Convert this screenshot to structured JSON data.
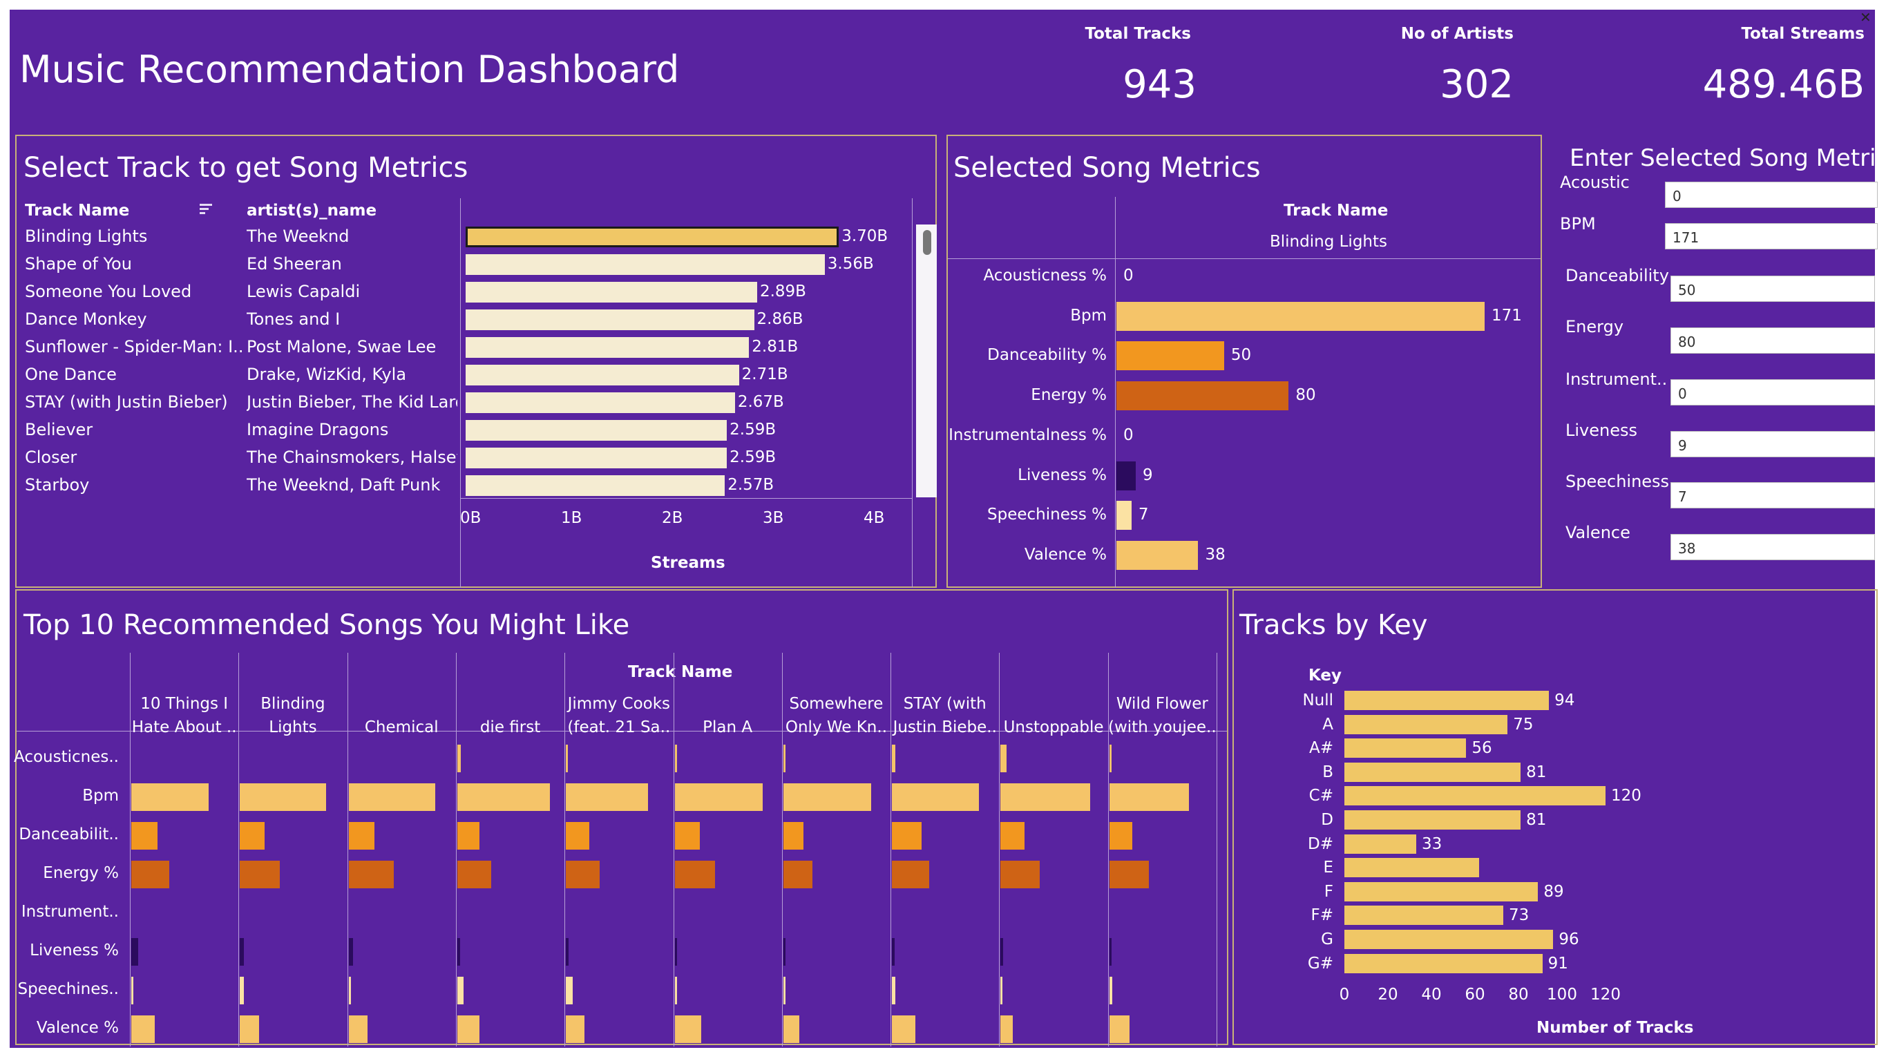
{
  "title": "Music Recommendation Dashboard",
  "kpis": [
    {
      "label": "Total Tracks",
      "value": "943"
    },
    {
      "label": "No of Artists",
      "value": "302"
    },
    {
      "label": "Total Streams",
      "value": "489.46B"
    }
  ],
  "colors": {
    "background": "#5923a0",
    "selected_bar": "#f0c766",
    "bar_light": "#f5ecd2",
    "bpm": "#f5c469",
    "danceability": "#f2971f",
    "energy": "#cf6315",
    "liveness": "#2b0b5e",
    "speechiness": "#fbe2a3",
    "valence": "#f5c469",
    "key_bar": "#f0c766"
  },
  "select_panel": {
    "title": "Select Track to get Song Metrics",
    "col_track": "Track Name",
    "col_artist": "artist(s)_name",
    "sort_icon": "sort-icon",
    "x_axis_title": "Streams",
    "x_ticks": [
      "0B",
      "1B",
      "2B",
      "3B",
      "4B"
    ],
    "rows": [
      {
        "track": "Blinding Lights",
        "artist": "The Weeknd",
        "label": "3.70B",
        "selected": true
      },
      {
        "track": "Shape of You",
        "artist": "Ed Sheeran",
        "label": "3.56B"
      },
      {
        "track": "Someone You Loved",
        "artist": "Lewis Capaldi",
        "label": "2.89B"
      },
      {
        "track": "Dance Monkey",
        "artist": "Tones and I",
        "label": "2.86B"
      },
      {
        "track": "Sunflower - Spider-Man: I..",
        "artist": "Post Malone, Swae Lee",
        "label": "2.81B"
      },
      {
        "track": "One Dance",
        "artist": "Drake, WizKid, Kyla",
        "label": "2.71B"
      },
      {
        "track": "STAY (with Justin Bieber)",
        "artist": "Justin Bieber, The Kid Laroi",
        "label": "2.67B"
      },
      {
        "track": "Believer",
        "artist": "Imagine Dragons",
        "label": "2.59B"
      },
      {
        "track": "Closer",
        "artist": "The Chainsmokers, Halsey",
        "label": "2.59B"
      },
      {
        "track": "Starboy",
        "artist": "The Weeknd, Daft Punk",
        "label": "2.57B"
      }
    ]
  },
  "metrics_panel": {
    "title": "Selected Song Metrics",
    "col_header": "Track Name",
    "track": "Blinding Lights",
    "metrics": [
      {
        "name": "Acousticness %",
        "value": 0,
        "label": "0",
        "color": "#f5c469"
      },
      {
        "name": "Bpm",
        "value": 171,
        "label": "171",
        "color": "#f5c469"
      },
      {
        "name": "Danceability %",
        "value": 50,
        "label": "50",
        "color": "#f2971f"
      },
      {
        "name": "Energy %",
        "value": 80,
        "label": "80",
        "color": "#cf6315"
      },
      {
        "name": "Instrumentalness %",
        "value": 0,
        "label": "0",
        "color": "#f5c469"
      },
      {
        "name": "Liveness %",
        "value": 9,
        "label": "9",
        "color": "#2b0b5e"
      },
      {
        "name": "Speechiness %",
        "value": 7,
        "label": "7",
        "color": "#fbe2a3"
      },
      {
        "name": "Valence %",
        "value": 38,
        "label": "38",
        "color": "#f5c469"
      }
    ]
  },
  "inputs_panel": {
    "title": "Enter Selected Song Metrics",
    "fields": [
      {
        "label": "Acoustic",
        "value": "0"
      },
      {
        "label": "BPM",
        "value": "171"
      },
      {
        "label": "Danceability",
        "value": "50"
      },
      {
        "label": "Energy",
        "value": "80"
      },
      {
        "label": "Instrument..",
        "value": "0"
      },
      {
        "label": "Liveness",
        "value": "9"
      },
      {
        "label": "Speechiness",
        "value": "7"
      },
      {
        "label": "Valence",
        "value": "38"
      }
    ]
  },
  "recommend_panel": {
    "title": "Top 10 Recommended Songs You Might Like",
    "col_header": "Track Name",
    "songs": [
      {
        "l1": "10 Things I",
        "l2": "Hate About .."
      },
      {
        "l1": "Blinding",
        "l2": "Lights"
      },
      {
        "l1": "",
        "l2": "Chemical"
      },
      {
        "l1": "",
        "l2": "die first"
      },
      {
        "l1": "Jimmy Cooks",
        "l2": "(feat. 21 Sa.."
      },
      {
        "l1": "",
        "l2": "Plan A"
      },
      {
        "l1": "Somewhere",
        "l2": "Only We Kn.."
      },
      {
        "l1": "STAY (with",
        "l2": "Justin Biebe.."
      },
      {
        "l1": "",
        "l2": "Unstoppable"
      },
      {
        "l1": "Wild Flower",
        "l2": "(with youjee.."
      }
    ],
    "row_labels": [
      "Acousticnes..",
      "Bpm",
      "Danceabilit..",
      "Energy %",
      "Instrument..",
      "Liveness %",
      "Speechines..",
      "Valence %"
    ]
  },
  "chart_data": [
    {
      "type": "bar",
      "title": "Select Track to get Song Metrics",
      "xlabel": "Streams",
      "categories": [
        "Blinding Lights",
        "Shape of You",
        "Someone You Loved",
        "Dance Monkey",
        "Sunflower - Spider-Man: I..",
        "One Dance",
        "STAY (with Justin Bieber)",
        "Believer",
        "Closer",
        "Starboy"
      ],
      "values": [
        3.7,
        3.56,
        2.89,
        2.86,
        2.81,
        2.71,
        2.67,
        2.59,
        2.59,
        2.57
      ],
      "xlim": [
        0,
        4.45
      ]
    },
    {
      "type": "bar",
      "title": "Selected Song Metrics",
      "categories": [
        "Acousticness %",
        "Bpm",
        "Danceability %",
        "Energy %",
        "Instrumentalness %",
        "Liveness %",
        "Speechiness %",
        "Valence %"
      ],
      "values": [
        0,
        171,
        50,
        80,
        0,
        9,
        7,
        38
      ],
      "xlim": [
        0,
        190
      ]
    },
    {
      "type": "bar",
      "title": "Top 10 Recommended Songs You Might Like",
      "categories": [
        "Acousticnes..",
        "Bpm",
        "Danceabilit..",
        "Energy %",
        "Instrument..",
        "Liveness %",
        "Speechines..",
        "Valence %"
      ],
      "series": [
        {
          "name": "10 Things I Hate About ..",
          "values": [
            0,
            124,
            42,
            61,
            0,
            11,
            3,
            38
          ]
        },
        {
          "name": "Blinding Lights",
          "values": [
            0,
            138,
            40,
            64,
            0,
            6,
            6,
            31
          ]
        },
        {
          "name": "Chemical",
          "values": [
            0,
            139,
            41,
            72,
            0,
            7,
            4,
            30
          ]
        },
        {
          "name": "die first",
          "values": [
            6,
            148,
            35,
            54,
            0,
            4,
            10,
            36
          ]
        },
        {
          "name": "Jimmy Cooks (feat. 21 Sa..",
          "values": [
            2,
            132,
            37,
            54,
            0,
            4,
            11,
            30
          ]
        },
        {
          "name": "Plan A",
          "values": [
            3,
            141,
            40,
            65,
            0,
            3,
            3,
            43
          ]
        },
        {
          "name": "Somewhere Only We Kn..",
          "values": [
            4,
            141,
            32,
            47,
            0,
            4,
            4,
            26
          ]
        },
        {
          "name": "STAY (with Justin Biebe..",
          "values": [
            5,
            139,
            47,
            60,
            0,
            4,
            5,
            38
          ]
        },
        {
          "name": "Unstoppable",
          "values": [
            9,
            144,
            38,
            63,
            0,
            4,
            3,
            20
          ]
        },
        {
          "name": "Wild Flower (with youjee..",
          "values": [
            2,
            128,
            37,
            64,
            0,
            4,
            5,
            33
          ]
        }
      ],
      "xlim": [
        0,
        155
      ]
    },
    {
      "type": "bar",
      "title": "Tracks by Key",
      "xlabel": "Number of Tracks",
      "ylabel": "Key",
      "categories": [
        "Null",
        "A",
        "A#",
        "B",
        "C#",
        "D",
        "D#",
        "E",
        "F",
        "F#",
        "G",
        "G#"
      ],
      "values": [
        94,
        75,
        56,
        81,
        120,
        81,
        33,
        62,
        89,
        73,
        96,
        91
      ],
      "data_labels": [
        "94",
        "75",
        "56",
        "81",
        "120",
        "81",
        "33",
        "",
        "89",
        "73",
        "96",
        "91"
      ],
      "x_ticks": [
        "0",
        "20",
        "40",
        "60",
        "80",
        "100",
        "120"
      ],
      "xlim": [
        0,
        130
      ]
    }
  ],
  "key_panel": {
    "title": "Tracks by Key",
    "ylabel": "Key",
    "xlabel": "Number of Tracks"
  },
  "window": {
    "close_glyph": "✕",
    "close_icon": "close-icon"
  }
}
